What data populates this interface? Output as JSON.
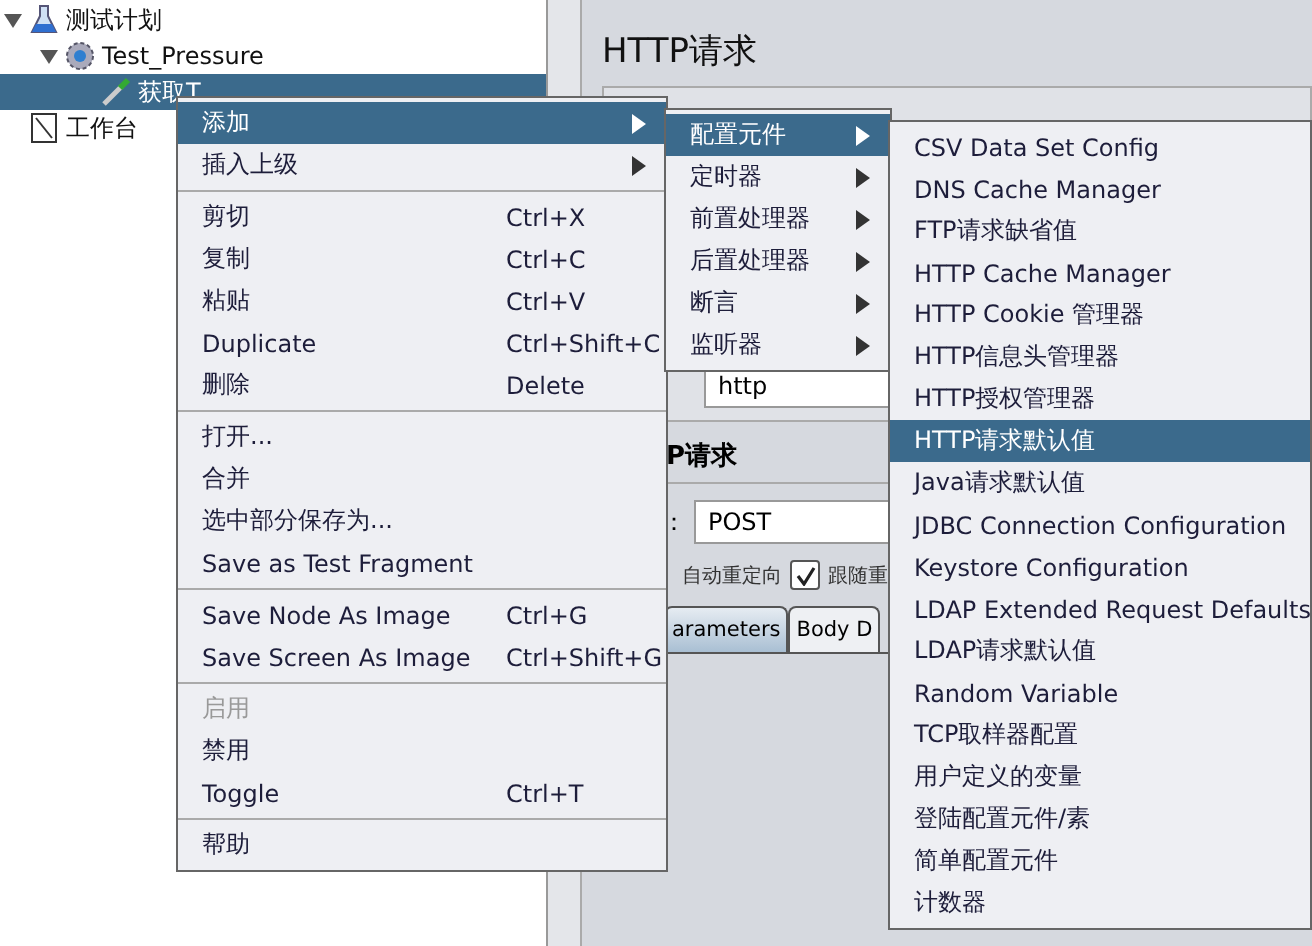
{
  "tree": [
    {
      "label": "测试计划",
      "kind": "flask",
      "expanded": true,
      "selected": false,
      "children": [
        {
          "label": "Test_Pressure",
          "kind": "gear",
          "expanded": true,
          "selected": false,
          "children": [
            {
              "label": "获取T",
              "kind": "dropper",
              "selected": true
            }
          ]
        }
      ]
    },
    {
      "label": "工作台",
      "kind": "notebook",
      "selected": false
    }
  ],
  "panel": {
    "title": "HTTP请求",
    "server_value": "http",
    "section_title": "P请求",
    "method_label": "：",
    "method_value": "POST",
    "redirect_label": "自动重定向",
    "follow": {
      "label": "跟随重",
      "checked": true
    },
    "tabs": [
      {
        "label": "arameters",
        "selected": true
      },
      {
        "label": "Body D",
        "selected": false
      }
    ]
  },
  "context_menu": [
    {
      "kind": "item",
      "label": "添加",
      "submenu": true,
      "selected": true
    },
    {
      "kind": "item",
      "label": "插入上级",
      "submenu": true,
      "selected": false
    },
    {
      "kind": "separator"
    },
    {
      "kind": "item",
      "label": "剪切",
      "shortcut": "Ctrl+X",
      "selected": false
    },
    {
      "kind": "item",
      "label": "复制",
      "shortcut": "Ctrl+C",
      "selected": false
    },
    {
      "kind": "item",
      "label": "粘贴",
      "shortcut": "Ctrl+V",
      "selected": false
    },
    {
      "kind": "item",
      "label": "Duplicate",
      "shortcut": "Ctrl+Shift+C",
      "selected": false
    },
    {
      "kind": "item",
      "label": "删除",
      "shortcut": "Delete",
      "selected": false
    },
    {
      "kind": "separator"
    },
    {
      "kind": "item",
      "label": "打开...",
      "selected": false
    },
    {
      "kind": "item",
      "label": "合并",
      "selected": false
    },
    {
      "kind": "item",
      "label": "选中部分保存为...",
      "selected": false
    },
    {
      "kind": "item",
      "label": "Save as Test Fragment",
      "selected": false
    },
    {
      "kind": "separator"
    },
    {
      "kind": "item",
      "label": "Save Node As Image",
      "shortcut": "Ctrl+G",
      "selected": false
    },
    {
      "kind": "item",
      "label": "Save Screen As Image",
      "shortcut": "Ctrl+Shift+G",
      "selected": false
    },
    {
      "kind": "separator"
    },
    {
      "kind": "item",
      "label": "启用",
      "disabled": true,
      "selected": false
    },
    {
      "kind": "item",
      "label": "禁用",
      "selected": false
    },
    {
      "kind": "item",
      "label": "Toggle",
      "shortcut": "Ctrl+T",
      "selected": false
    },
    {
      "kind": "separator"
    },
    {
      "kind": "item",
      "label": "帮助",
      "selected": false
    }
  ],
  "add_submenu": [
    {
      "kind": "item",
      "label": "配置元件",
      "submenu": true,
      "selected": true
    },
    {
      "kind": "item",
      "label": "定时器",
      "submenu": true,
      "selected": false
    },
    {
      "kind": "item",
      "label": "前置处理器",
      "submenu": true,
      "selected": false
    },
    {
      "kind": "item",
      "label": "后置处理器",
      "submenu": true,
      "selected": false
    },
    {
      "kind": "item",
      "label": "断言",
      "submenu": true,
      "selected": false
    },
    {
      "kind": "item",
      "label": "监听器",
      "submenu": true,
      "selected": false
    }
  ],
  "config_submenu": [
    {
      "kind": "item",
      "label": "CSV Data Set Config",
      "selected": false
    },
    {
      "kind": "item",
      "label": "DNS Cache Manager",
      "selected": false
    },
    {
      "kind": "item",
      "label": "FTP请求缺省值",
      "selected": false
    },
    {
      "kind": "item",
      "label": "HTTP Cache Manager",
      "selected": false
    },
    {
      "kind": "item",
      "label": "HTTP Cookie 管理器",
      "selected": false
    },
    {
      "kind": "item",
      "label": "HTTP信息头管理器",
      "selected": false
    },
    {
      "kind": "item",
      "label": "HTTP授权管理器",
      "selected": false
    },
    {
      "kind": "item",
      "label": "HTTP请求默认值",
      "selected": true
    },
    {
      "kind": "item",
      "label": "Java请求默认值",
      "selected": false
    },
    {
      "kind": "item",
      "label": "JDBC Connection Configuration",
      "selected": false
    },
    {
      "kind": "item",
      "label": "Keystore Configuration",
      "selected": false
    },
    {
      "kind": "item",
      "label": "LDAP Extended Request Defaults",
      "selected": false
    },
    {
      "kind": "item",
      "label": "LDAP请求默认值",
      "selected": false
    },
    {
      "kind": "item",
      "label": "Random Variable",
      "selected": false
    },
    {
      "kind": "item",
      "label": "TCP取样器配置",
      "selected": false
    },
    {
      "kind": "item",
      "label": "用户定义的变量",
      "selected": false
    },
    {
      "kind": "item",
      "label": "登陆配置元件/素",
      "selected": false
    },
    {
      "kind": "item",
      "label": "简单配置元件",
      "selected": false
    },
    {
      "kind": "item",
      "label": "计数器",
      "selected": false
    }
  ]
}
